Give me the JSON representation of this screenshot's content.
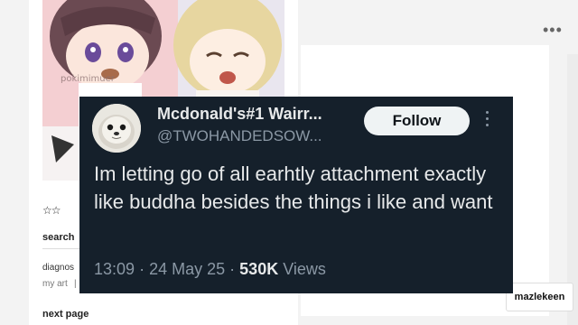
{
  "background_page": {
    "artwork_watermark": "pokimimuer",
    "stars": "☆☆",
    "search_label": "search",
    "diagnosis_text": "diagnos",
    "my_art_link": "my art",
    "my_art_separator": "|",
    "next_page_link": "next page",
    "more_menu_icon": "dots-horizontal-icon",
    "user_tag": "mazlekeen"
  },
  "tweet": {
    "display_name": "Mcdonald's#1 Wairr...",
    "handle": "@TWOHANDEDSOW...",
    "follow_label": "Follow",
    "text": "Im letting go of all earhtly attachment exactly like buddha besides the things i like and want",
    "time": "13:09",
    "date": "24 May 25",
    "separator": "·",
    "views_count": "530K",
    "views_label": "Views",
    "avatar_icon": "seal-avatar-icon",
    "more_icon": "vertical-dots-icon",
    "colors": {
      "background": "#15202b",
      "text": "#e7e9ea",
      "secondary": "#8b98a5",
      "button": "#eff3f4"
    }
  }
}
